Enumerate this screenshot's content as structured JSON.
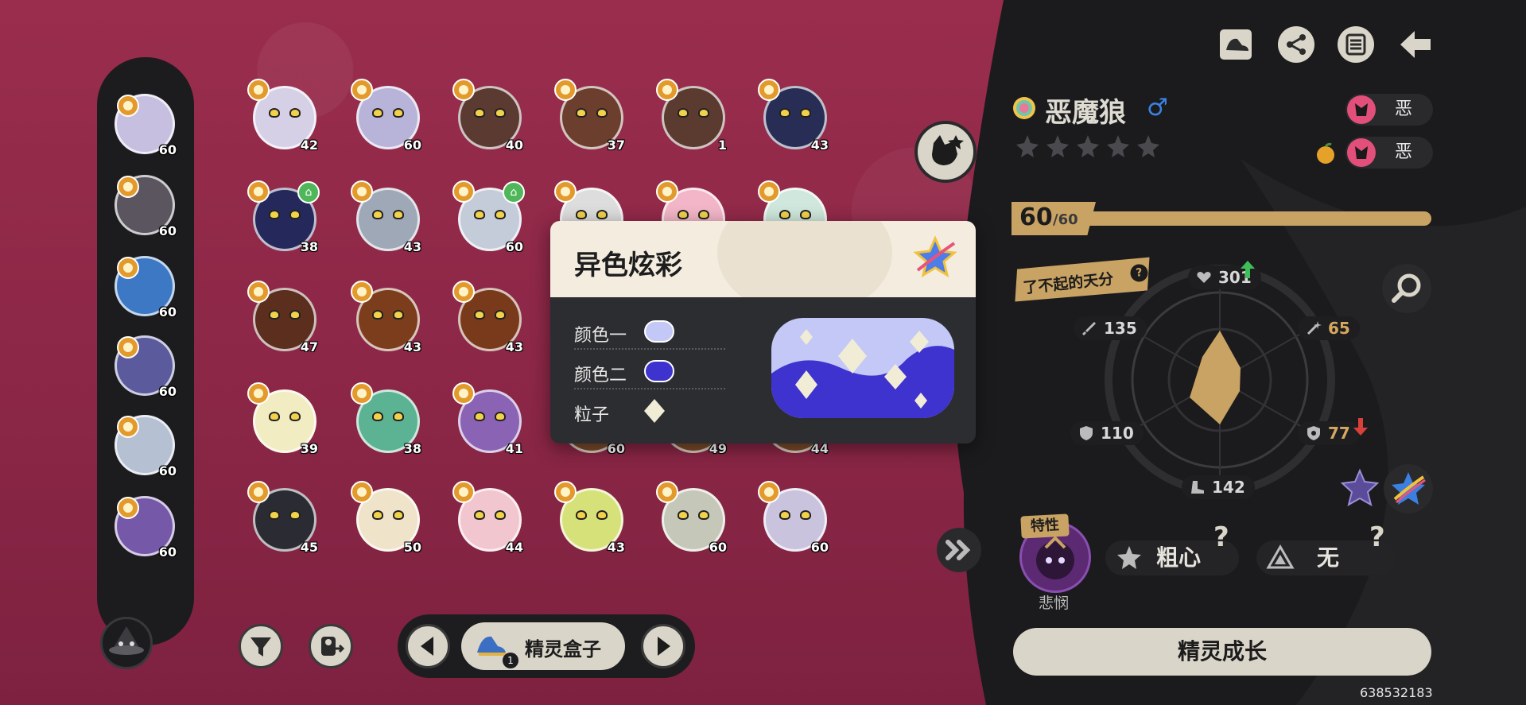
{
  "pet": {
    "name": "恶魔狼",
    "gender_symbol": "♂",
    "type_chip_1": "恶",
    "type_chip_2": "恶",
    "level_current": "60",
    "level_max": "/60",
    "talent_label": "了不起的天分",
    "talent_help": "?",
    "stats": {
      "hp": "301",
      "attack": "135",
      "sp_attack": "65",
      "defense": "110",
      "sp_defense": "77",
      "speed": "142"
    },
    "stat_arrows": {
      "hp": "up",
      "sp_defense": "down"
    },
    "trait_tag": "特性",
    "trait_name": "悲悯",
    "nature_label": "粗心",
    "nature_help": "?",
    "item_label": "无",
    "item_help": "?",
    "grow_button": "精灵成长"
  },
  "popup": {
    "title": "异色炫彩",
    "rows": [
      {
        "label": "颜色一",
        "color": "#c3c8f6"
      },
      {
        "label": "颜色二",
        "color": "#3e33cf"
      },
      {
        "label": "粒子",
        "color": "#f1ecd6"
      }
    ]
  },
  "team": [
    {
      "level": "60"
    },
    {
      "level": "60"
    },
    {
      "level": "60"
    },
    {
      "level": "60"
    },
    {
      "level": "60"
    },
    {
      "level": "60"
    }
  ],
  "grid": [
    {
      "level": "42",
      "color": "#d5d0e6",
      "home": false
    },
    {
      "level": "60",
      "color": "#b8b3d8",
      "home": false
    },
    {
      "level": "40",
      "color": "#5a3a31",
      "home": false
    },
    {
      "level": "37",
      "color": "#6b3e2d",
      "home": false
    },
    {
      "level": "1",
      "color": "#5b3a2f",
      "home": false
    },
    {
      "level": "43",
      "color": "#272d55",
      "home": false
    },
    {
      "level": "38",
      "color": "#25285a",
      "home": true
    },
    {
      "level": "43",
      "color": "#9ea8b6",
      "home": false
    },
    {
      "level": "60",
      "color": "#c4ccd9",
      "home": true
    },
    {
      "level": "",
      "color": "#ddd",
      "home": false
    },
    {
      "level": "",
      "color": "#f2b6c8",
      "home": false
    },
    {
      "level": "",
      "color": "#cfe7dc",
      "home": false
    },
    {
      "level": "47",
      "color": "#5b2e1e",
      "home": false
    },
    {
      "level": "43",
      "color": "#7c3d1d",
      "home": false
    },
    {
      "level": "43",
      "color": "#793a1b",
      "home": false
    },
    {
      "level": "",
      "color": "#7b4a2a",
      "home": false
    },
    {
      "level": "",
      "color": "#7b4a2a",
      "home": false
    },
    {
      "level": "",
      "color": "#7b4a2a",
      "home": false
    },
    {
      "level": "39",
      "color": "#f2ecc2",
      "home": false
    },
    {
      "level": "38",
      "color": "#5bb394",
      "home": false
    },
    {
      "level": "41",
      "color": "#8a63b5",
      "home": false
    },
    {
      "level": "60",
      "color": "#7b4a2a",
      "home": false
    },
    {
      "level": "49",
      "color": "#7b4a2a",
      "home": false
    },
    {
      "level": "44",
      "color": "#7b4a2a",
      "home": false
    },
    {
      "level": "45",
      "color": "#2b2b34",
      "home": false
    },
    {
      "level": "50",
      "color": "#efe3c9",
      "home": false
    },
    {
      "level": "44",
      "color": "#f1c6cf",
      "home": false
    },
    {
      "level": "43",
      "color": "#d7e17a",
      "home": false
    },
    {
      "level": "60",
      "color": "#c5c8b8",
      "home": false
    },
    {
      "level": "60",
      "color": "#c9c3dd",
      "home": false
    }
  ],
  "box": {
    "label": "精灵盒子",
    "count": "1"
  },
  "footer": {
    "uid": "638532183"
  },
  "icons": {
    "top": [
      "shoe-book-icon",
      "share-icon",
      "list-icon",
      "back-arrow-icon"
    ],
    "filter": "filter-icon",
    "transfer": "transfer-icon",
    "magnify": "magnify-icon",
    "collapse": "double-chevron-icon"
  },
  "colors": {
    "bg": "#8f2a49",
    "panel": "#1c1c1f",
    "gold": "#c9a364",
    "badge": "#e39a2c"
  }
}
